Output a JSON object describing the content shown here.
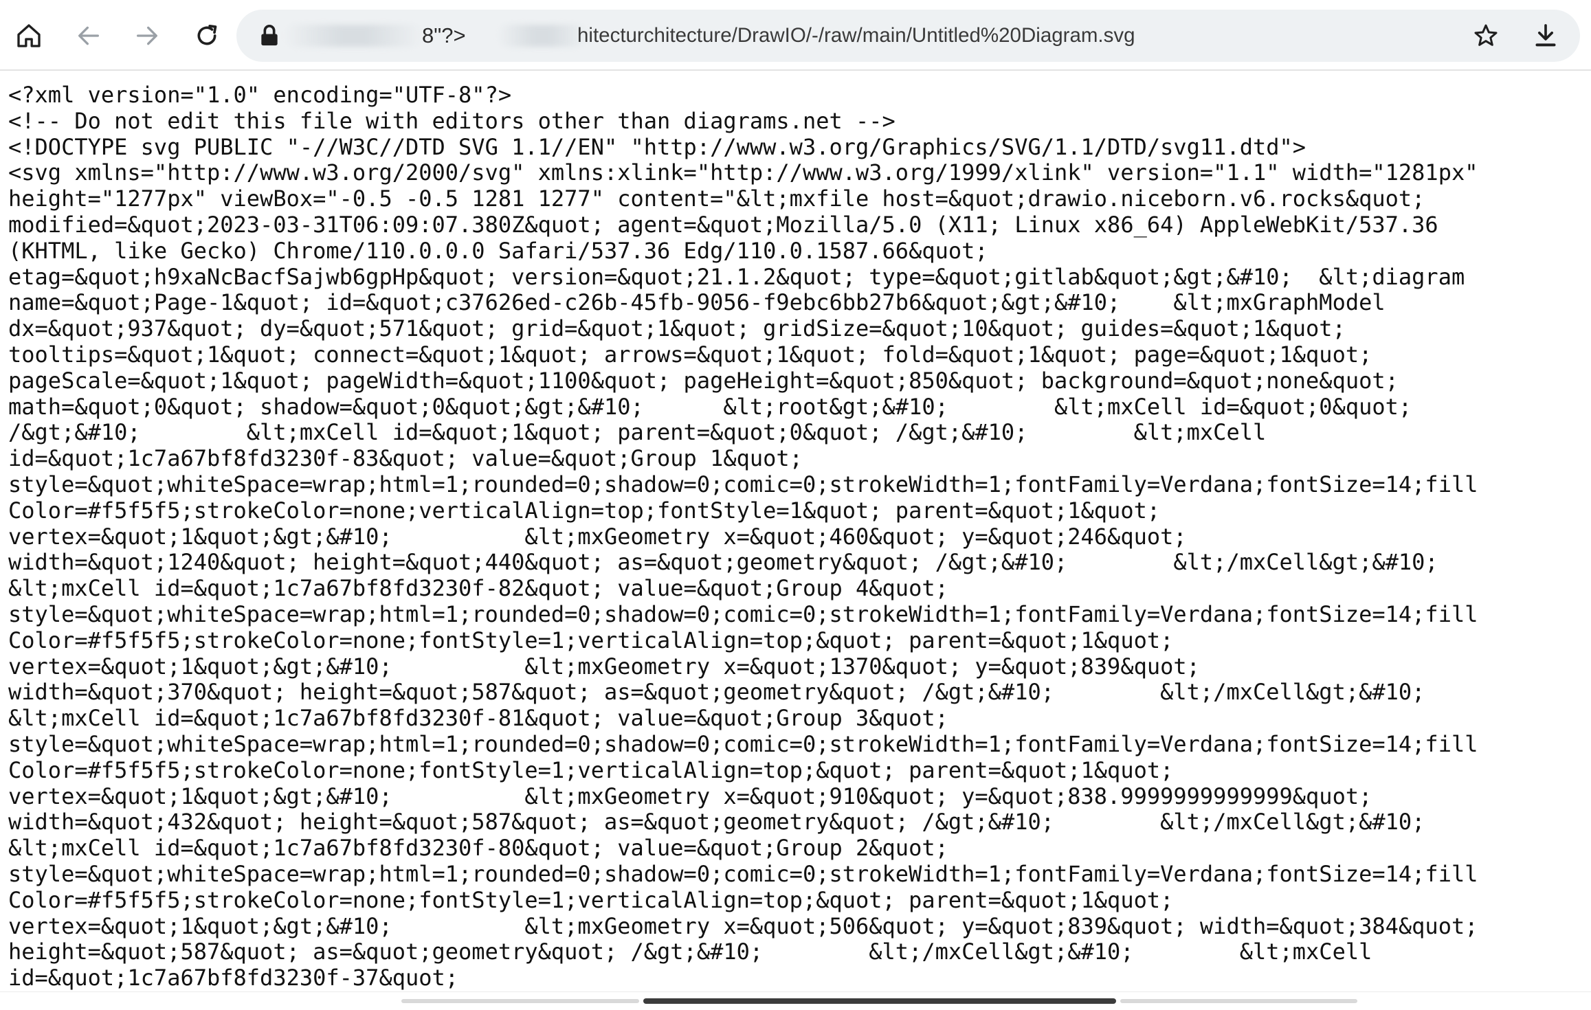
{
  "browser": {
    "toolbar": {
      "home_icon": "home-icon",
      "back_icon": "arrow-left-icon",
      "forward_icon": "arrow-right-icon",
      "reload_icon": "reload-icon"
    },
    "omnibox": {
      "lock_icon": "lock-icon",
      "url_fragment": "8\"?>",
      "url_visible": "hitecturchitecture/DrawIO/-/raw/main/Untitled%20Diagram.svg",
      "bookmark_icon": "star-icon",
      "download_icon": "download-icon"
    }
  },
  "document": {
    "lines": [
      "<?xml version=\"1.0\" encoding=\"UTF-8\"?>",
      "<!-- Do not edit this file with editors other than diagrams.net -->",
      "<!DOCTYPE svg PUBLIC \"-//W3C//DTD SVG 1.1//EN\" \"http://www.w3.org/Graphics/SVG/1.1/DTD/svg11.dtd\">",
      "<svg xmlns=\"http://www.w3.org/2000/svg\" xmlns:xlink=\"http://www.w3.org/1999/xlink\" version=\"1.1\" width=\"1281px\"",
      "height=\"1277px\" viewBox=\"-0.5 -0.5 1281 1277\" content=\"&lt;mxfile host=&quot;drawio.niceborn.v6.rocks&quot;",
      "modified=&quot;2023-03-31T06:09:07.380Z&quot; agent=&quot;Mozilla/5.0 (X11; Linux x86_64) AppleWebKit/537.36",
      "(KHTML, like Gecko) Chrome/110.0.0.0 Safari/537.36 Edg/110.0.1587.66&quot;",
      "etag=&quot;h9xaNcBacfSajwb6gpHp&quot; version=&quot;21.1.2&quot; type=&quot;gitlab&quot;&gt;&#10;  &lt;diagram",
      "name=&quot;Page-1&quot; id=&quot;c37626ed-c26b-45fb-9056-f9ebc6bb27b6&quot;&gt;&#10;    &lt;mxGraphModel",
      "dx=&quot;937&quot; dy=&quot;571&quot; grid=&quot;1&quot; gridSize=&quot;10&quot; guides=&quot;1&quot;",
      "tooltips=&quot;1&quot; connect=&quot;1&quot; arrows=&quot;1&quot; fold=&quot;1&quot; page=&quot;1&quot;",
      "pageScale=&quot;1&quot; pageWidth=&quot;1100&quot; pageHeight=&quot;850&quot; background=&quot;none&quot;",
      "math=&quot;0&quot; shadow=&quot;0&quot;&gt;&#10;      &lt;root&gt;&#10;        &lt;mxCell id=&quot;0&quot;",
      "/&gt;&#10;        &lt;mxCell id=&quot;1&quot; parent=&quot;0&quot; /&gt;&#10;        &lt;mxCell",
      "id=&quot;1c7a67bf8fd3230f-83&quot; value=&quot;Group 1&quot;",
      "style=&quot;whiteSpace=wrap;html=1;rounded=0;shadow=0;comic=0;strokeWidth=1;fontFamily=Verdana;fontSize=14;fill",
      "Color=#f5f5f5;strokeColor=none;verticalAlign=top;fontStyle=1&quot; parent=&quot;1&quot;",
      "vertex=&quot;1&quot;&gt;&#10;          &lt;mxGeometry x=&quot;460&quot; y=&quot;246&quot;",
      "width=&quot;1240&quot; height=&quot;440&quot; as=&quot;geometry&quot; /&gt;&#10;        &lt;/mxCell&gt;&#10;",
      "&lt;mxCell id=&quot;1c7a67bf8fd3230f-82&quot; value=&quot;Group 4&quot;",
      "style=&quot;whiteSpace=wrap;html=1;rounded=0;shadow=0;comic=0;strokeWidth=1;fontFamily=Verdana;fontSize=14;fill",
      "Color=#f5f5f5;strokeColor=none;fontStyle=1;verticalAlign=top;&quot; parent=&quot;1&quot;",
      "vertex=&quot;1&quot;&gt;&#10;          &lt;mxGeometry x=&quot;1370&quot; y=&quot;839&quot;",
      "width=&quot;370&quot; height=&quot;587&quot; as=&quot;geometry&quot; /&gt;&#10;        &lt;/mxCell&gt;&#10;",
      "&lt;mxCell id=&quot;1c7a67bf8fd3230f-81&quot; value=&quot;Group 3&quot;",
      "style=&quot;whiteSpace=wrap;html=1;rounded=0;shadow=0;comic=0;strokeWidth=1;fontFamily=Verdana;fontSize=14;fill",
      "Color=#f5f5f5;strokeColor=none;fontStyle=1;verticalAlign=top;&quot; parent=&quot;1&quot;",
      "vertex=&quot;1&quot;&gt;&#10;          &lt;mxGeometry x=&quot;910&quot; y=&quot;838.9999999999999&quot;",
      "width=&quot;432&quot; height=&quot;587&quot; as=&quot;geometry&quot; /&gt;&#10;        &lt;/mxCell&gt;&#10;",
      "&lt;mxCell id=&quot;1c7a67bf8fd3230f-80&quot; value=&quot;Group 2&quot;",
      "style=&quot;whiteSpace=wrap;html=1;rounded=0;shadow=0;comic=0;strokeWidth=1;fontFamily=Verdana;fontSize=14;fill",
      "Color=#f5f5f5;strokeColor=none;fontStyle=1;verticalAlign=top;&quot; parent=&quot;1&quot;",
      "vertex=&quot;1&quot;&gt;&#10;          &lt;mxGeometry x=&quot;506&quot; y=&quot;839&quot; width=&quot;384&quot;",
      "height=&quot;587&quot; as=&quot;geometry&quot; /&gt;&#10;        &lt;/mxCell&gt;&#10;        &lt;mxCell",
      "id=&quot;1c7a67bf8fd3230f-37&quot;"
    ]
  },
  "colors": {
    "omnibox_bg": "#eef1f3",
    "text": "#111111",
    "icon": "#1f1f1f",
    "icon_disabled": "#9aa0a6"
  }
}
